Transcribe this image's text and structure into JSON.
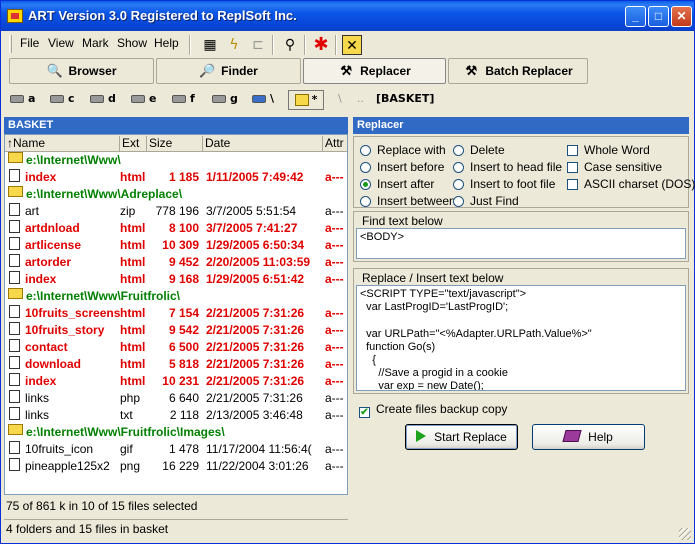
{
  "window": {
    "title": "ART Version 3.0 Registered to ReplSoft Inc.",
    "controls": [
      "_",
      "□",
      "✕"
    ]
  },
  "menu": [
    "File",
    "View",
    "Mark",
    "Show",
    "Help"
  ],
  "toolbar_icons": [
    "grid-icon",
    "lightning-icon",
    "tree-icon",
    "wand-icon",
    "asterisk-icon",
    "exit-icon"
  ],
  "tabs": [
    {
      "label": "Browser",
      "icon": "browser-icon"
    },
    {
      "label": "Finder",
      "icon": "finder-icon"
    },
    {
      "label": "Replacer",
      "icon": "hammer-icon",
      "active": true
    },
    {
      "label": "Batch Replacer",
      "icon": "hammer-icon"
    }
  ],
  "drives": [
    "a",
    "c",
    "d",
    "e",
    "f",
    "g",
    "\\",
    "*",
    "\\",
    "..",
    "[BASKET]"
  ],
  "left": {
    "title": "BASKET",
    "columns": [
      "↑Name",
      "Ext",
      "Size",
      "Date",
      "Attr"
    ],
    "rows": [
      {
        "type": "folder",
        "name": "e:\\Internet\\Www\\"
      },
      {
        "type": "red",
        "name": "index",
        "ext": "html",
        "size": "1 185",
        "date": "1/11/2005 7:49:42",
        "attr": "a---"
      },
      {
        "type": "folder",
        "name": "e:\\Internet\\Www\\Adreplace\\"
      },
      {
        "type": "normal",
        "name": "art",
        "ext": "zip",
        "size": "778 196",
        "date": "3/7/2005 5:51:54",
        "attr": "a---"
      },
      {
        "type": "red",
        "name": "artdnload",
        "ext": "html",
        "size": "8 100",
        "date": "3/7/2005 7:41:27",
        "attr": "a---"
      },
      {
        "type": "red",
        "name": "artlicense",
        "ext": "html",
        "size": "10 309",
        "date": "1/29/2005 6:50:34",
        "attr": "a---"
      },
      {
        "type": "red",
        "name": "artorder",
        "ext": "html",
        "size": "9 452",
        "date": "2/20/2005 11:03:59",
        "attr": "a---"
      },
      {
        "type": "red",
        "name": "index",
        "ext": "html",
        "size": "9 168",
        "date": "1/29/2005 6:51:42",
        "attr": "a---"
      },
      {
        "type": "folder",
        "name": "e:\\Internet\\Www\\Fruitfrolic\\"
      },
      {
        "type": "red",
        "name": "10fruits_screens",
        "ext": "html",
        "size": "7 154",
        "date": "2/21/2005 7:31:26",
        "attr": "a---"
      },
      {
        "type": "red",
        "name": "10fruits_story",
        "ext": "html",
        "size": "9 542",
        "date": "2/21/2005 7:31:26",
        "attr": "a---"
      },
      {
        "type": "red",
        "name": "contact",
        "ext": "html",
        "size": "6 500",
        "date": "2/21/2005 7:31:26",
        "attr": "a---"
      },
      {
        "type": "red",
        "name": "download",
        "ext": "html",
        "size": "5 818",
        "date": "2/21/2005 7:31:26",
        "attr": "a---"
      },
      {
        "type": "red",
        "name": "index",
        "ext": "html",
        "size": "10 231",
        "date": "2/21/2005 7:31:26",
        "attr": "a---"
      },
      {
        "type": "normal",
        "name": "links",
        "ext": "php",
        "size": "6 640",
        "date": "2/21/2005 7:31:26",
        "attr": "a---"
      },
      {
        "type": "normal",
        "name": "links",
        "ext": "txt",
        "size": "2 118",
        "date": "2/13/2005 3:46:48",
        "attr": "a---"
      },
      {
        "type": "folder",
        "name": "e:\\Internet\\Www\\Fruitfrolic\\Images\\"
      },
      {
        "type": "normal",
        "name": "10fruits_icon",
        "ext": "gif",
        "size": "1 478",
        "date": "11/17/2004 11:56:4(",
        "attr": "a---"
      },
      {
        "type": "normal",
        "name": "pineapple125x2",
        "ext": "png",
        "size": "16 229",
        "date": "11/22/2004 3:01:26",
        "attr": "a---"
      }
    ],
    "status_selected": "75 of 861 k in 10 of 15 files selected",
    "status_basket": "4 folders and 15 files in basket"
  },
  "right": {
    "title": "Replacer",
    "radios": [
      {
        "label": "Replace with",
        "checked": false
      },
      {
        "label": "Insert before",
        "checked": false
      },
      {
        "label": "Insert after",
        "checked": true
      },
      {
        "label": "Insert between",
        "checked": false
      },
      {
        "label": "Delete",
        "checked": false
      },
      {
        "label": "Insert to head file",
        "checked": false
      },
      {
        "label": "Insert to foot file",
        "checked": false
      },
      {
        "label": "Just Find",
        "checked": false
      }
    ],
    "checks": [
      {
        "label": "Whole Word",
        "checked": false
      },
      {
        "label": "Case sensitive",
        "checked": false
      },
      {
        "label": "ASCII charset (DOS)",
        "checked": false
      }
    ],
    "find_label": "Find text below",
    "find_text": "<BODY>",
    "replace_label": "Replace / Insert text below",
    "replace_text": "<SCRIPT TYPE=\"text/javascript\">\n  var LastProgID='LastProgID';\n\n  var URLPath=\"<%Adapter.URLPath.Value%>\"\n  function Go(s)\n    {\n      //Save a progid in a cookie\n      var exp = new Date();",
    "backup_label": "Create files backup copy",
    "backup_checked": true,
    "start_label": "Start Replace",
    "help_label": "Help"
  }
}
